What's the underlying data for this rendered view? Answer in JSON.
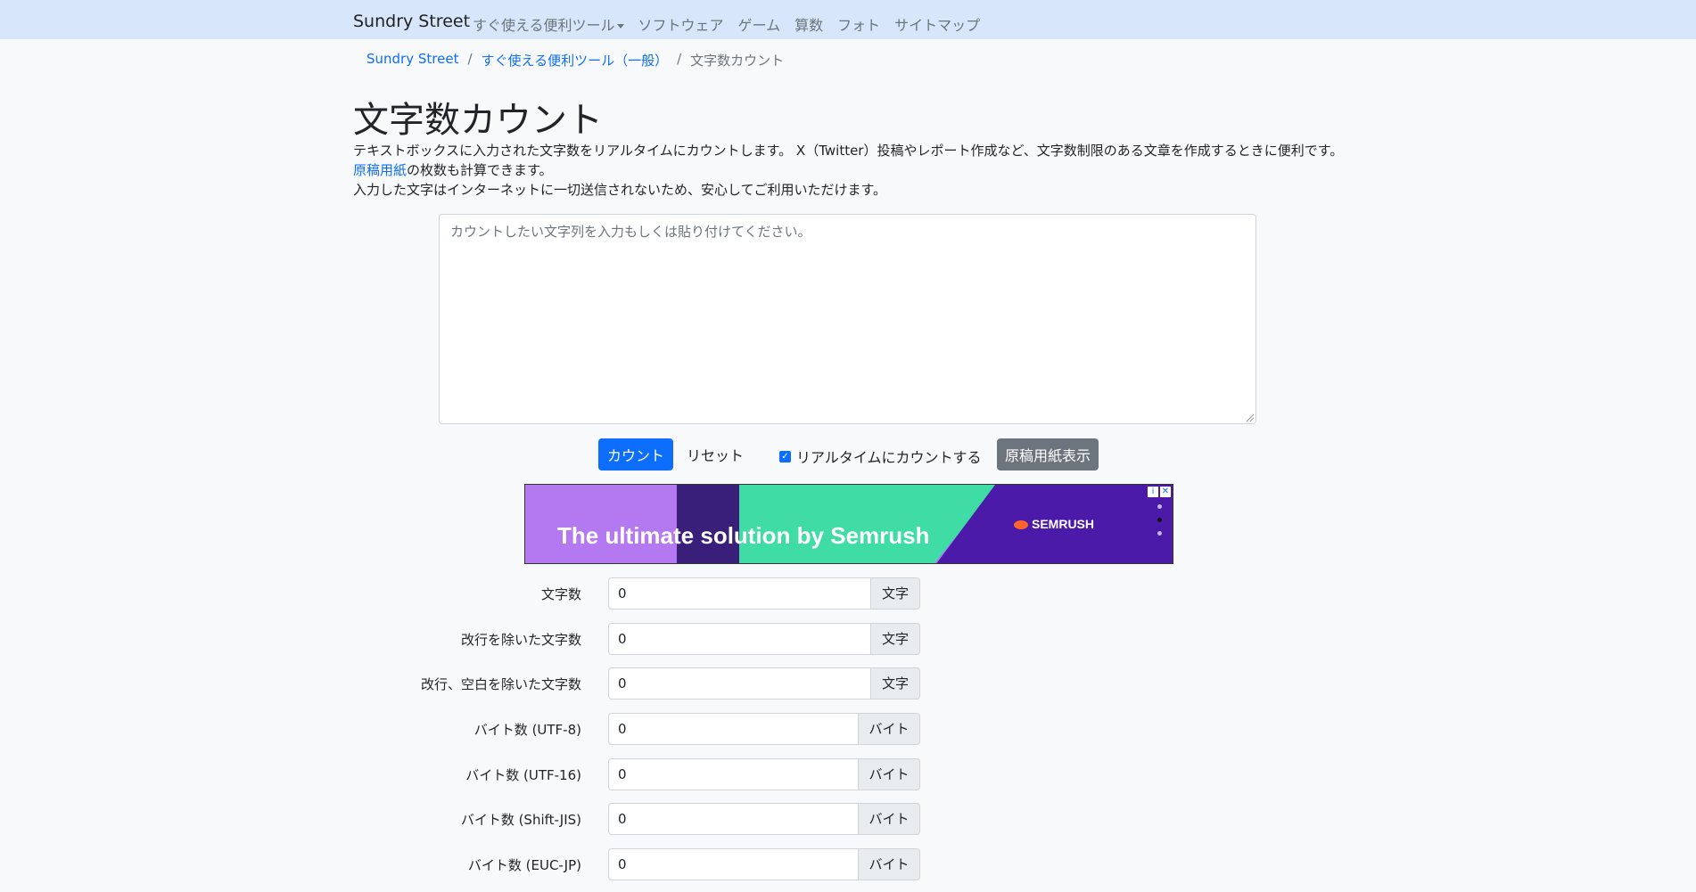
{
  "navbar": {
    "brand": "Sundry Street",
    "items": [
      {
        "label": "すぐ使える便利ツール"
      },
      {
        "label": "ソフトウェア"
      },
      {
        "label": "ゲーム"
      },
      {
        "label": "算数"
      },
      {
        "label": "フォト"
      },
      {
        "label": "サイトマップ"
      }
    ]
  },
  "breadcrumb": {
    "home": "Sundry Street",
    "parent": "すぐ使える便利ツール（一般）",
    "current": "文字数カウント",
    "separator": "/"
  },
  "page": {
    "title": "文字数カウント",
    "desc_line1": "テキストボックスに入力された文字数をリアルタイムにカウントします。 X（Twitter）投稿やレポート作成など、文字数制限のある文章を作成するときに便利です。",
    "desc_line2_link": "原稿用紙",
    "desc_line2_rest": "の枚数も計算できます。",
    "desc_line3": "入力した文字はインターネットに一切送信されないため、安心してご利用いただけます。"
  },
  "textarea": {
    "placeholder": "カウントしたい文字列を入力もしくは貼り付けてください。",
    "value": ""
  },
  "actions": {
    "count_label": "カウント",
    "reset_label": "リセット",
    "realtime_label": "リアルタイムにカウントする",
    "realtime_checked": true,
    "manuscript_label": "原稿用紙表示"
  },
  "ad": {
    "headline": "The ultimate solution by Semrush",
    "logo": "SEMRUSH",
    "info_icon": "info-icon",
    "close_icon": "close-icon"
  },
  "results": [
    {
      "label": "文字数",
      "value": "0",
      "unit": "文字"
    },
    {
      "label": "改行を除いた文字数",
      "value": "0",
      "unit": "文字"
    },
    {
      "label": "改行、空白を除いた文字数",
      "value": "0",
      "unit": "文字"
    },
    {
      "label": "バイト数 (UTF-8)",
      "value": "0",
      "unit": "バイト"
    },
    {
      "label": "バイト数 (UTF-16)",
      "value": "0",
      "unit": "バイト"
    },
    {
      "label": "バイト数 (Shift-JIS)",
      "value": "0",
      "unit": "バイト"
    },
    {
      "label": "バイト数 (EUC-JP)",
      "value": "0",
      "unit": "バイト"
    }
  ]
}
